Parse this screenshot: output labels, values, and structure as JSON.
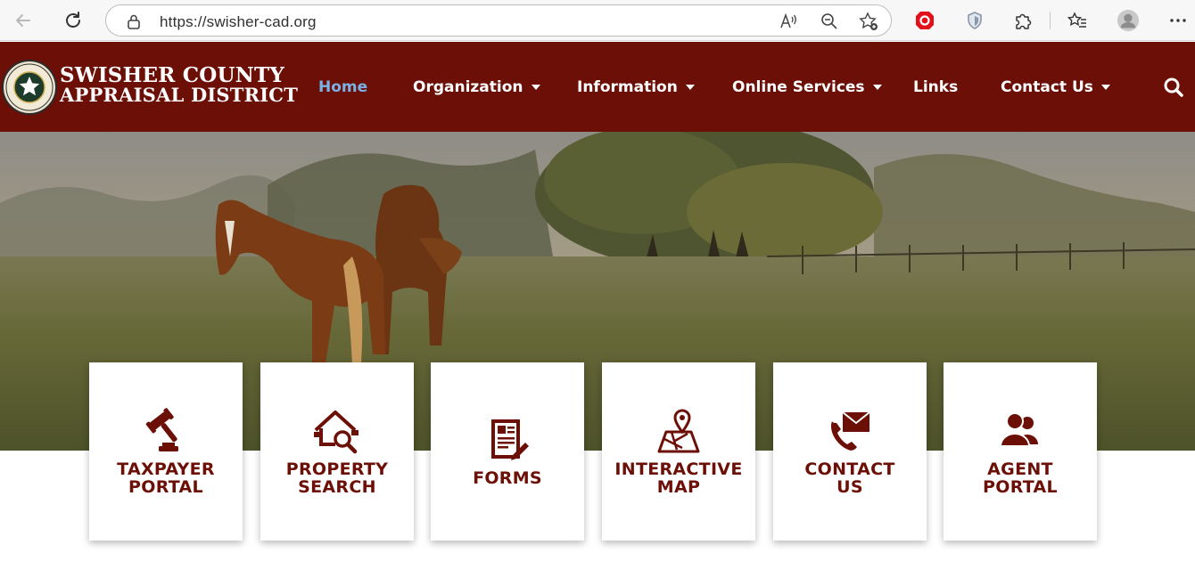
{
  "browser": {
    "url": "https://swisher-cad.org",
    "icons": [
      "back-arrow-icon",
      "refresh-icon",
      "lock-icon",
      "read-aloud-icon",
      "zoom-out-icon",
      "add-favorite-icon",
      "extension-red-icon",
      "shield-icon",
      "puzzle-icon",
      "favorites-icon",
      "profile-icon",
      "more-icon"
    ]
  },
  "site": {
    "logo": {
      "line1": "SWISHER COUNTY",
      "line2": "APPRAISAL DISTRICT"
    },
    "nav": [
      {
        "label": "Home",
        "active": true,
        "dropdown": false
      },
      {
        "label": "Organization",
        "active": false,
        "dropdown": true
      },
      {
        "label": "Information",
        "active": false,
        "dropdown": true
      },
      {
        "label": "Online Services",
        "active": false,
        "dropdown": true
      },
      {
        "label": "Links",
        "active": false,
        "dropdown": false
      },
      {
        "label": "Contact Us",
        "active": false,
        "dropdown": true
      }
    ],
    "colors": {
      "brand": "#6c0f06",
      "active_nav": "#7ab2e6",
      "card_text": "#6c0f06"
    }
  },
  "cards": [
    {
      "label": "TAXPAYER\nPORTAL",
      "icon": "gavel-icon"
    },
    {
      "label": "PROPERTY\nSEARCH",
      "icon": "house-search-icon"
    },
    {
      "label": "FORMS",
      "icon": "document-form-icon"
    },
    {
      "label": "INTERACTIVE\nMAP",
      "icon": "map-pin-icon"
    },
    {
      "label": "CONTACT\nUS",
      "icon": "phone-envelope-icon"
    },
    {
      "label": "AGENT\nPORTAL",
      "icon": "users-icon"
    }
  ]
}
